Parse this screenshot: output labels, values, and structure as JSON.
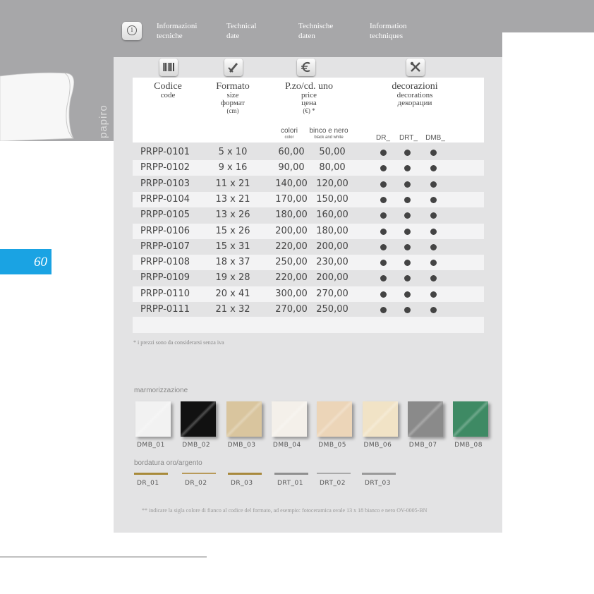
{
  "header": {
    "items": [
      {
        "line1": "Informazioni",
        "line2": "tecniche"
      },
      {
        "line1": "Technical",
        "line2": "date"
      },
      {
        "line1": "Technische",
        "line2": "daten"
      },
      {
        "line1": "Information",
        "line2": "techniques"
      }
    ]
  },
  "side_label": "papiro",
  "page_number": "60",
  "table": {
    "col_code": {
      "title": "Codice",
      "l1": "code"
    },
    "col_format": {
      "title": "Formato",
      "l1": "size",
      "l2": "формат",
      "l3": "(cm)"
    },
    "col_price": {
      "title": "P.zo/cd. uno",
      "l1": "price",
      "l2": "цена",
      "l3": "(€) *"
    },
    "col_deco": {
      "title": "decorazioni",
      "l1": "decorations",
      "l2": "декорации"
    },
    "sub_colori": "colori",
    "sub_colori_small": "color",
    "sub_binco": "binco e nero",
    "sub_binco_small": "black and white",
    "deco_codes": [
      "DR_",
      "DRT_",
      "DMB_"
    ],
    "rows": [
      {
        "code": "PRPP-0101",
        "size": "5 x 10",
        "color": "60,00",
        "bw": "50,00"
      },
      {
        "code": "PRPP-0102",
        "size": "9 x 16",
        "color": "90,00",
        "bw": "80,00"
      },
      {
        "code": "PRPP-0103",
        "size": "11 x 21",
        "color": "140,00",
        "bw": "120,00"
      },
      {
        "code": "PRPP-0104",
        "size": "13 x 21",
        "color": "170,00",
        "bw": "150,00"
      },
      {
        "code": "PRPP-0105",
        "size": "13 x 26",
        "color": "180,00",
        "bw": "160,00"
      },
      {
        "code": "PRPP-0106",
        "size": "15 x 26",
        "color": "200,00",
        "bw": "180,00"
      },
      {
        "code": "PRPP-0107",
        "size": "15 x 31",
        "color": "220,00",
        "bw": "200,00"
      },
      {
        "code": "PRPP-0108",
        "size": "18 x 37",
        "color": "250,00",
        "bw": "230,00"
      },
      {
        "code": "PRPP-0109",
        "size": "19 x 28",
        "color": "220,00",
        "bw": "200,00"
      },
      {
        "code": "PRPP-0110",
        "size": "20 x 41",
        "color": "300,00",
        "bw": "270,00"
      },
      {
        "code": "PRPP-0111",
        "size": "21 x 32",
        "color": "270,00",
        "bw": "250,00"
      }
    ]
  },
  "vat_note": "* i prezzi sono da considerarsi senza iva",
  "marble": {
    "title": "marmorizzazione",
    "swatches": [
      {
        "label": "DMB_01",
        "color": "#f2f2f2"
      },
      {
        "label": "DMB_02",
        "color": "#111111"
      },
      {
        "label": "DMB_03",
        "color": "#d9c59e"
      },
      {
        "label": "DMB_04",
        "color": "#f4f0ea"
      },
      {
        "label": "DMB_05",
        "color": "#ecd5b8"
      },
      {
        "label": "DMB_06",
        "color": "#f1e3c6"
      },
      {
        "label": "DMB_07",
        "color": "#8a8a8a"
      },
      {
        "label": "DMB_08",
        "color": "#3e8a64"
      }
    ]
  },
  "border": {
    "title": "bordatura oro/argento",
    "items": [
      {
        "label": "DR_01",
        "color": "#a88a3a"
      },
      {
        "label": "DR_02",
        "color": "#b89a5a"
      },
      {
        "label": "DR_03",
        "color": "#a8893d"
      },
      {
        "label": "DRT_01",
        "color": "#909090"
      },
      {
        "label": "DRT_02",
        "color": "#a9a9a9"
      },
      {
        "label": "DRT_03",
        "color": "#9a9a9a"
      }
    ]
  },
  "footnote": "** indicare la sigla colore di fianco al codice del formato, ad esempio: fotoceramica ovale 13 x 18 bianco e nero OV-0005-BN"
}
